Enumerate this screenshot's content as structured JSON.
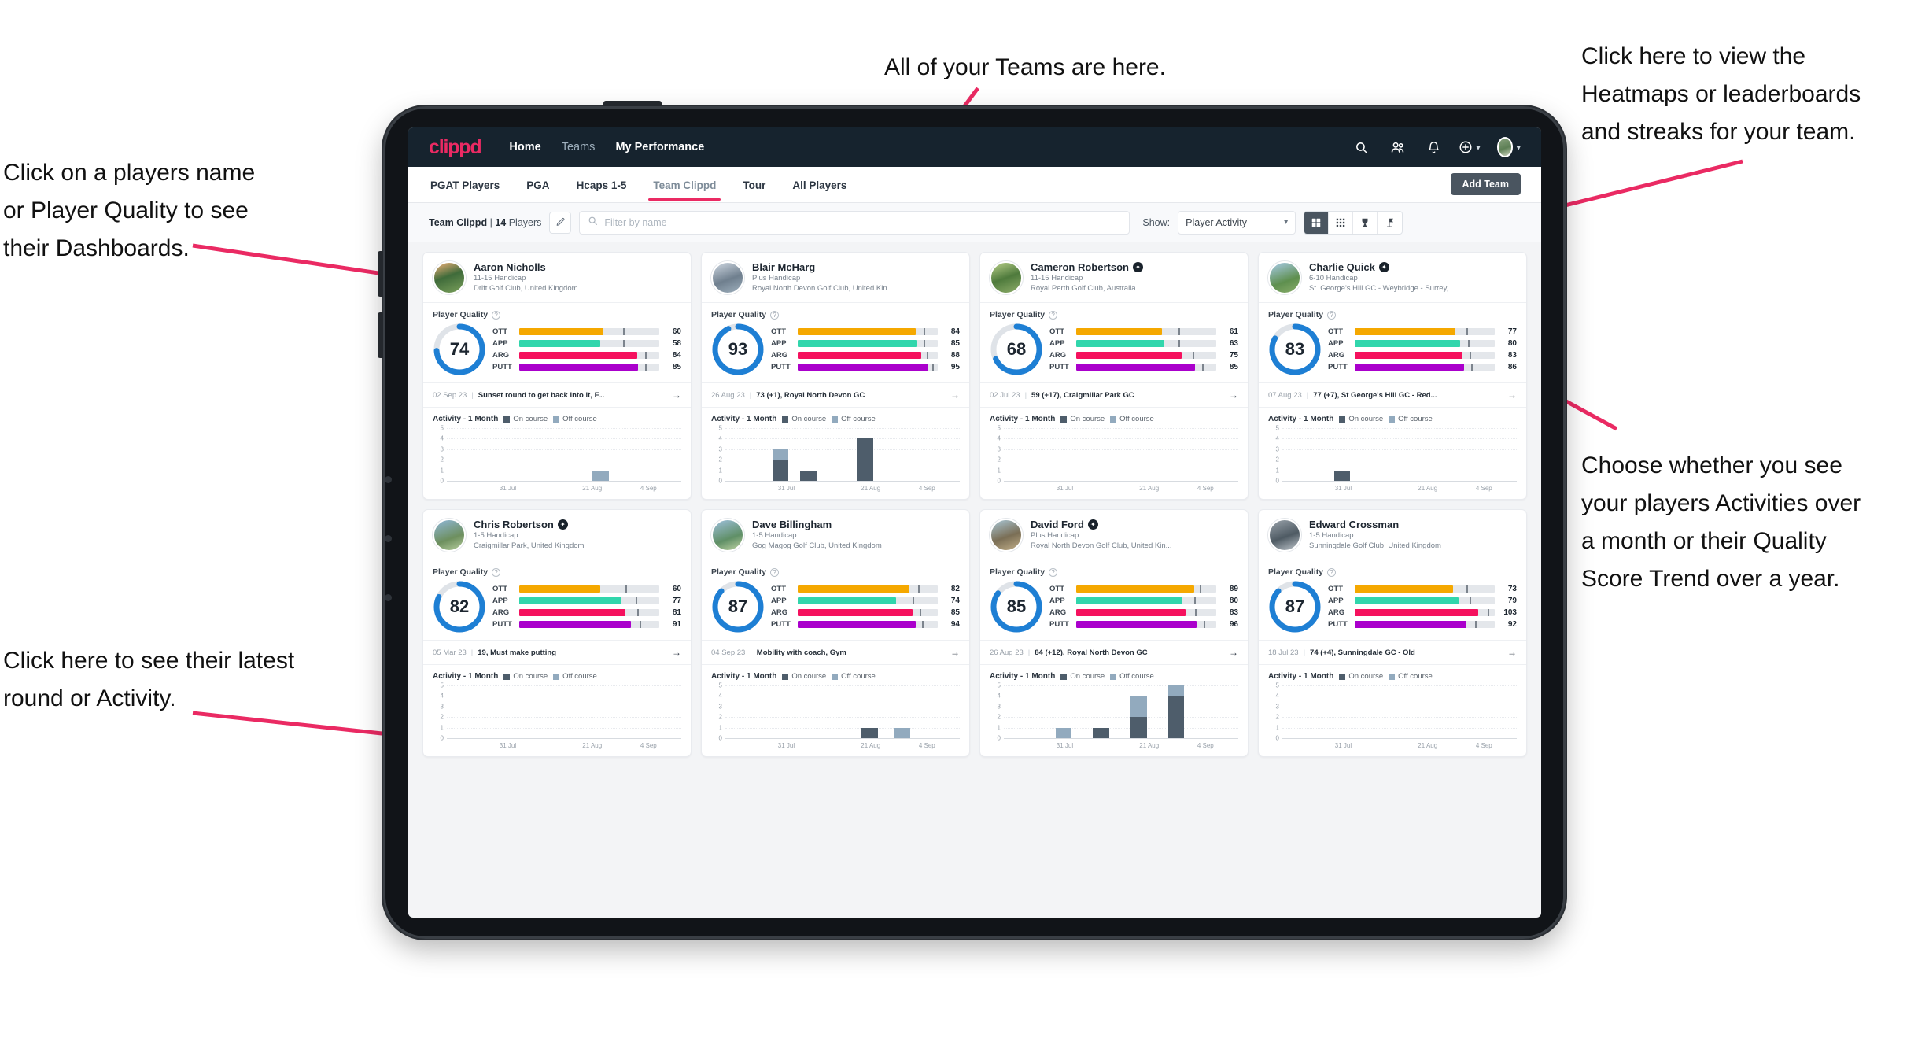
{
  "annotations": [
    {
      "id": "players-name",
      "text": "Click on a players name\nor Player Quality to see\ntheir Dashboards."
    },
    {
      "id": "teams-here",
      "text": "All of your Teams are here."
    },
    {
      "id": "heatmaps",
      "text": "Click here to view the\nHeatmaps or leaderboards\nand streaks for your team."
    },
    {
      "id": "activity-choice",
      "text": "Choose whether you see\nyour players Activities over\na month or their Quality\nScore Trend over a year."
    },
    {
      "id": "latest-round",
      "text": "Click here to see their latest\nround or Activity."
    }
  ],
  "colors": {
    "brand_pink": "#ea2a63",
    "nav_dark": "#16232e",
    "ring_blue": "#1e7fd4",
    "ott": "#f5a800",
    "app": "#31d6ac",
    "arg": "#f5115e",
    "putt": "#aa00cc",
    "on_course": "#4e5d6b",
    "off_course": "#92aabe"
  },
  "topnav": {
    "brand": "clippd",
    "links": [
      {
        "label": "Home",
        "active": true
      },
      {
        "label": "Teams",
        "active": false
      },
      {
        "label": "My Performance",
        "active": true
      }
    ],
    "icons": [
      "search-icon",
      "people-icon",
      "bell-icon",
      "plus-circle-icon",
      "avatar"
    ]
  },
  "tabs": [
    {
      "label": "PGAT Players",
      "active": false
    },
    {
      "label": "PGA",
      "active": false
    },
    {
      "label": "Hcaps 1-5",
      "active": false
    },
    {
      "label": "Team Clippd",
      "active": true
    },
    {
      "label": "Tour",
      "active": false
    },
    {
      "label": "All Players",
      "active": false
    }
  ],
  "add_team_label": "Add Team",
  "filterbar": {
    "team_name": "Team Clippd",
    "separator": "|",
    "player_count": "14",
    "players_word": "Players",
    "edit_icon": "pencil-icon",
    "search_placeholder": "Filter by name",
    "search_value": "",
    "show_label": "Show:",
    "show_value": "Player Activity",
    "show_options": [
      "Player Activity",
      "Quality Score Trend"
    ],
    "view_buttons": [
      "grid-view-icon",
      "dense-grid-icon",
      "trophy-icon",
      "flagstick-icon"
    ],
    "active_view": 0
  },
  "card_labels": {
    "player_quality": "Player Quality",
    "activity_title": "Activity - 1 Month",
    "legend_on": "On course",
    "legend_off": "Off course",
    "metric_labels": [
      "OTT",
      "APP",
      "ARG",
      "PUTT"
    ]
  },
  "chart_data": {
    "type": "bar",
    "title": "Activity - 1 Month",
    "ylabel": "",
    "xlabel": "",
    "ylim": [
      0,
      5
    ],
    "yticks": [
      0,
      1,
      2,
      3,
      4,
      5
    ],
    "xticks": [
      "31 Jul",
      "21 Aug",
      "4 Sep"
    ],
    "legend": [
      "On course",
      "Off course"
    ],
    "legend_position": "top",
    "grid": true,
    "series_colors": {
      "On course": "#4e5d6b",
      "Off course": "#92aabe"
    }
  },
  "players": [
    {
      "name": "Aaron Nicholls",
      "verified": false,
      "handicap": "11-15 Handicap",
      "club": "Drift Golf Club, United Kingdom",
      "quality": 74,
      "metrics": [
        {
          "label": "OTT",
          "value": 60,
          "fill": 60,
          "tick": 74
        },
        {
          "label": "APP",
          "value": 58,
          "fill": 58,
          "tick": 74
        },
        {
          "label": "ARG",
          "value": 84,
          "fill": 84,
          "tick": 90
        },
        {
          "label": "PUTT",
          "value": 85,
          "fill": 85,
          "tick": 90
        }
      ],
      "round_date": "02 Sep 23",
      "round_text": "Sunset round to get back into it, F...",
      "activity": [
        {
          "x": 62,
          "on": 0,
          "off": 1
        }
      ]
    },
    {
      "name": "Blair McHarg",
      "verified": false,
      "handicap": "Plus Handicap",
      "club": "Royal North Devon Golf Club, United Kin...",
      "quality": 93,
      "metrics": [
        {
          "label": "OTT",
          "value": 84,
          "fill": 84,
          "tick": 90
        },
        {
          "label": "APP",
          "value": 85,
          "fill": 85,
          "tick": 90
        },
        {
          "label": "ARG",
          "value": 88,
          "fill": 88,
          "tick": 92
        },
        {
          "label": "PUTT",
          "value": 95,
          "fill": 93,
          "tick": 96
        }
      ],
      "round_date": "26 Aug 23",
      "round_text": "73 (+1), Royal North Devon GC",
      "activity": [
        {
          "x": 20,
          "on": 2,
          "off": 1
        },
        {
          "x": 32,
          "on": 1,
          "off": 0
        },
        {
          "x": 56,
          "on": 4,
          "off": 0
        }
      ]
    },
    {
      "name": "Cameron Robertson",
      "verified": true,
      "handicap": "11-15 Handicap",
      "club": "Royal Perth Golf Club, Australia",
      "quality": 68,
      "metrics": [
        {
          "label": "OTT",
          "value": 61,
          "fill": 61,
          "tick": 73
        },
        {
          "label": "APP",
          "value": 63,
          "fill": 63,
          "tick": 73
        },
        {
          "label": "ARG",
          "value": 75,
          "fill": 75,
          "tick": 83
        },
        {
          "label": "PUTT",
          "value": 85,
          "fill": 85,
          "tick": 90
        }
      ],
      "round_date": "02 Jul 23",
      "round_text": "59 (+17), Craigmillar Park GC",
      "activity": []
    },
    {
      "name": "Charlie Quick",
      "verified": true,
      "handicap": "6-10 Handicap",
      "club": "St. George's Hill GC - Weybridge - Surrey, ...",
      "quality": 83,
      "metrics": [
        {
          "label": "OTT",
          "value": 77,
          "fill": 72,
          "tick": 80
        },
        {
          "label": "APP",
          "value": 80,
          "fill": 75,
          "tick": 81
        },
        {
          "label": "ARG",
          "value": 83,
          "fill": 77,
          "tick": 82
        },
        {
          "label": "PUTT",
          "value": 86,
          "fill": 78,
          "tick": 83
        }
      ],
      "round_date": "07 Aug 23",
      "round_text": "77 (+7), St George's Hill GC - Red...",
      "activity": [
        {
          "x": 22,
          "on": 1,
          "off": 0
        }
      ]
    },
    {
      "name": "Chris Robertson",
      "verified": true,
      "handicap": "1-5 Handicap",
      "club": "Craigmillar Park, United Kingdom",
      "quality": 82,
      "metrics": [
        {
          "label": "OTT",
          "value": 60,
          "fill": 58,
          "tick": 76
        },
        {
          "label": "APP",
          "value": 77,
          "fill": 73,
          "tick": 83
        },
        {
          "label": "ARG",
          "value": 81,
          "fill": 76,
          "tick": 84
        },
        {
          "label": "PUTT",
          "value": 91,
          "fill": 80,
          "tick": 86
        }
      ],
      "round_date": "05 Mar 23",
      "round_text": "19, Must make putting",
      "activity": []
    },
    {
      "name": "Dave Billingham",
      "verified": false,
      "handicap": "1-5 Handicap",
      "club": "Gog Magog Golf Club, United Kingdom",
      "quality": 87,
      "metrics": [
        {
          "label": "OTT",
          "value": 82,
          "fill": 80,
          "tick": 86
        },
        {
          "label": "APP",
          "value": 74,
          "fill": 70,
          "tick": 82
        },
        {
          "label": "ARG",
          "value": 85,
          "fill": 82,
          "tick": 87
        },
        {
          "label": "PUTT",
          "value": 94,
          "fill": 84,
          "tick": 89
        }
      ],
      "round_date": "04 Sep 23",
      "round_text": "Mobility with coach, Gym",
      "activity": [
        {
          "x": 58,
          "on": 1,
          "off": 0
        },
        {
          "x": 72,
          "on": 0,
          "off": 1
        }
      ]
    },
    {
      "name": "David Ford",
      "verified": true,
      "handicap": "Plus Handicap",
      "club": "Royal North Devon Golf Club, United Kin...",
      "quality": 85,
      "metrics": [
        {
          "label": "OTT",
          "value": 89,
          "fill": 84,
          "tick": 88
        },
        {
          "label": "APP",
          "value": 80,
          "fill": 76,
          "tick": 84
        },
        {
          "label": "ARG",
          "value": 83,
          "fill": 78,
          "tick": 85
        },
        {
          "label": "PUTT",
          "value": 96,
          "fill": 86,
          "tick": 91
        }
      ],
      "round_date": "26 Aug 23",
      "round_text": "84 (+12), Royal North Devon GC",
      "activity": [
        {
          "x": 22,
          "on": 0,
          "off": 1
        },
        {
          "x": 38,
          "on": 1,
          "off": 0
        },
        {
          "x": 54,
          "on": 2,
          "off": 2
        },
        {
          "x": 70,
          "on": 4,
          "off": 1
        }
      ]
    },
    {
      "name": "Edward Crossman",
      "verified": false,
      "handicap": "1-5 Handicap",
      "club": "Sunningdale Golf Club, United Kingdom",
      "quality": 87,
      "metrics": [
        {
          "label": "OTT",
          "value": 73,
          "fill": 70,
          "tick": 80
        },
        {
          "label": "APP",
          "value": 79,
          "fill": 74,
          "tick": 82
        },
        {
          "label": "ARG",
          "value": 103,
          "fill": 88,
          "tick": 95
        },
        {
          "label": "PUTT",
          "value": 92,
          "fill": 80,
          "tick": 86
        }
      ],
      "round_date": "18 Jul 23",
      "round_text": "74 (+4), Sunningdale GC - Old",
      "activity": []
    }
  ]
}
